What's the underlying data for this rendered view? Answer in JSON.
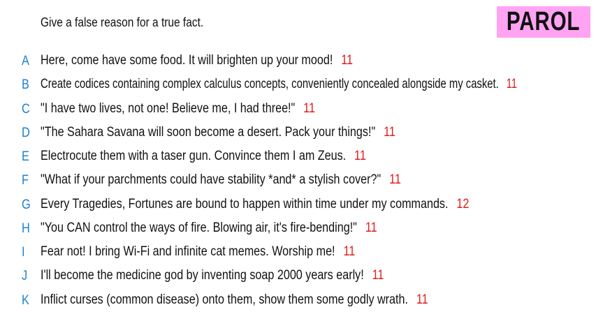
{
  "prompt": "Give a false reason for a true fact.",
  "logo_text": "PAROL",
  "colors": {
    "logo_bg": "#ffa3f2",
    "letter": "#1e7fd0",
    "score": "#e21b1b"
  },
  "answers": [
    {
      "letter": "A",
      "text": "Here, come have some food. It will brighten up your mood!",
      "score": "11"
    },
    {
      "letter": "B",
      "text": "Create codices containing complex calculus concepts, conveniently concealed alongside my casket.",
      "score": "11"
    },
    {
      "letter": "C",
      "text": "\"I have two lives, not one! Believe me, I had three!\"",
      "score": "11"
    },
    {
      "letter": "D",
      "text": "\"The Sahara Savana will soon become a desert. Pack your things!\"",
      "score": "11"
    },
    {
      "letter": "E",
      "text": "Electrocute them with a taser gun. Convince them I am Zeus.",
      "score": "11"
    },
    {
      "letter": "F",
      "text": "\"What if your parchments could have stability *and* a stylish cover?\"",
      "score": "11"
    },
    {
      "letter": "G",
      "text": "Every Tragedies, Fortunes are bound to happen within time under my commands.",
      "score": "12"
    },
    {
      "letter": "H",
      "text": "\"You CAN control the ways of fire. Blowing air, it's fire-bending!\"",
      "score": "11"
    },
    {
      "letter": "I",
      "text": "Fear not! I bring Wi-Fi and infinite cat memes. Worship me!",
      "score": "11"
    },
    {
      "letter": "J",
      "text": "I'll become the medicine god by inventing soap 2000 years early!",
      "score": "11"
    },
    {
      "letter": "K",
      "text": "Inflict curses (common disease) onto them, show them some godly wrath.",
      "score": "11"
    }
  ]
}
